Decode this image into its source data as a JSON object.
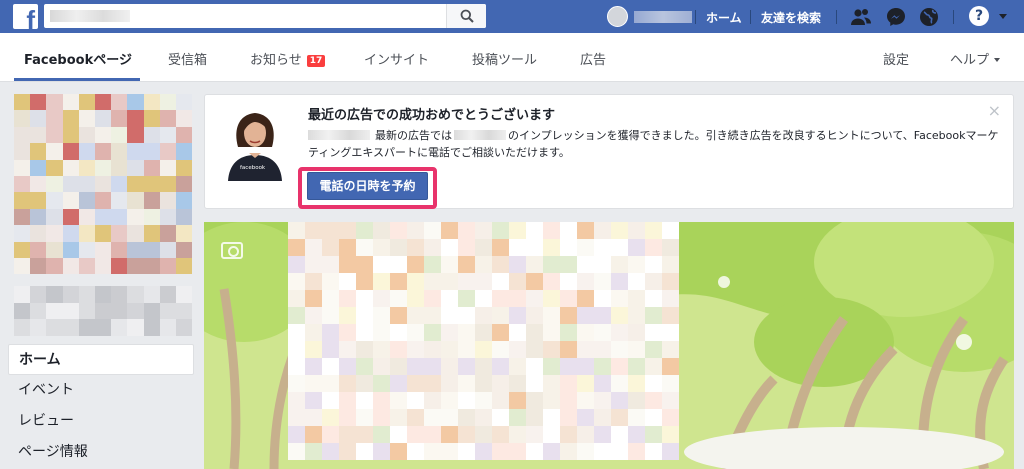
{
  "topbar": {
    "logo": "f",
    "search_placeholder": "",
    "links": {
      "home": "ホーム",
      "find_friends": "友達を検索"
    },
    "icons": [
      "friends-icon",
      "messenger-icon",
      "globe-icon",
      "help-icon"
    ],
    "help_label": "?"
  },
  "page_nav": {
    "tabs": [
      {
        "label": "Facebookページ",
        "active": true
      },
      {
        "label": "受信箱"
      },
      {
        "label": "お知らせ",
        "badge": "17"
      },
      {
        "label": "インサイト"
      },
      {
        "label": "投稿ツール"
      },
      {
        "label": "広告"
      }
    ],
    "settings": "設定",
    "help": "ヘルプ"
  },
  "left_menu": [
    "ホーム",
    "イベント",
    "レビュー",
    "ページ情報"
  ],
  "card": {
    "title": "最近の広告での成功おめでとうございます",
    "body_part1": "最新の広告では",
    "body_part2": "のインプレッションを獲得できました。引き続き広告を改良するヒントについて、Facebookマーケティングエキスパートに電話でご相談いただけます。",
    "cta": "電話の日時を予約",
    "close": "×",
    "shirt_text": "facebook"
  },
  "colors": {
    "brand_blue": "#4267b2",
    "highlight_pink": "#e8336b",
    "badge_red": "#fa3e3e",
    "cover_green": "#cfe58f"
  }
}
